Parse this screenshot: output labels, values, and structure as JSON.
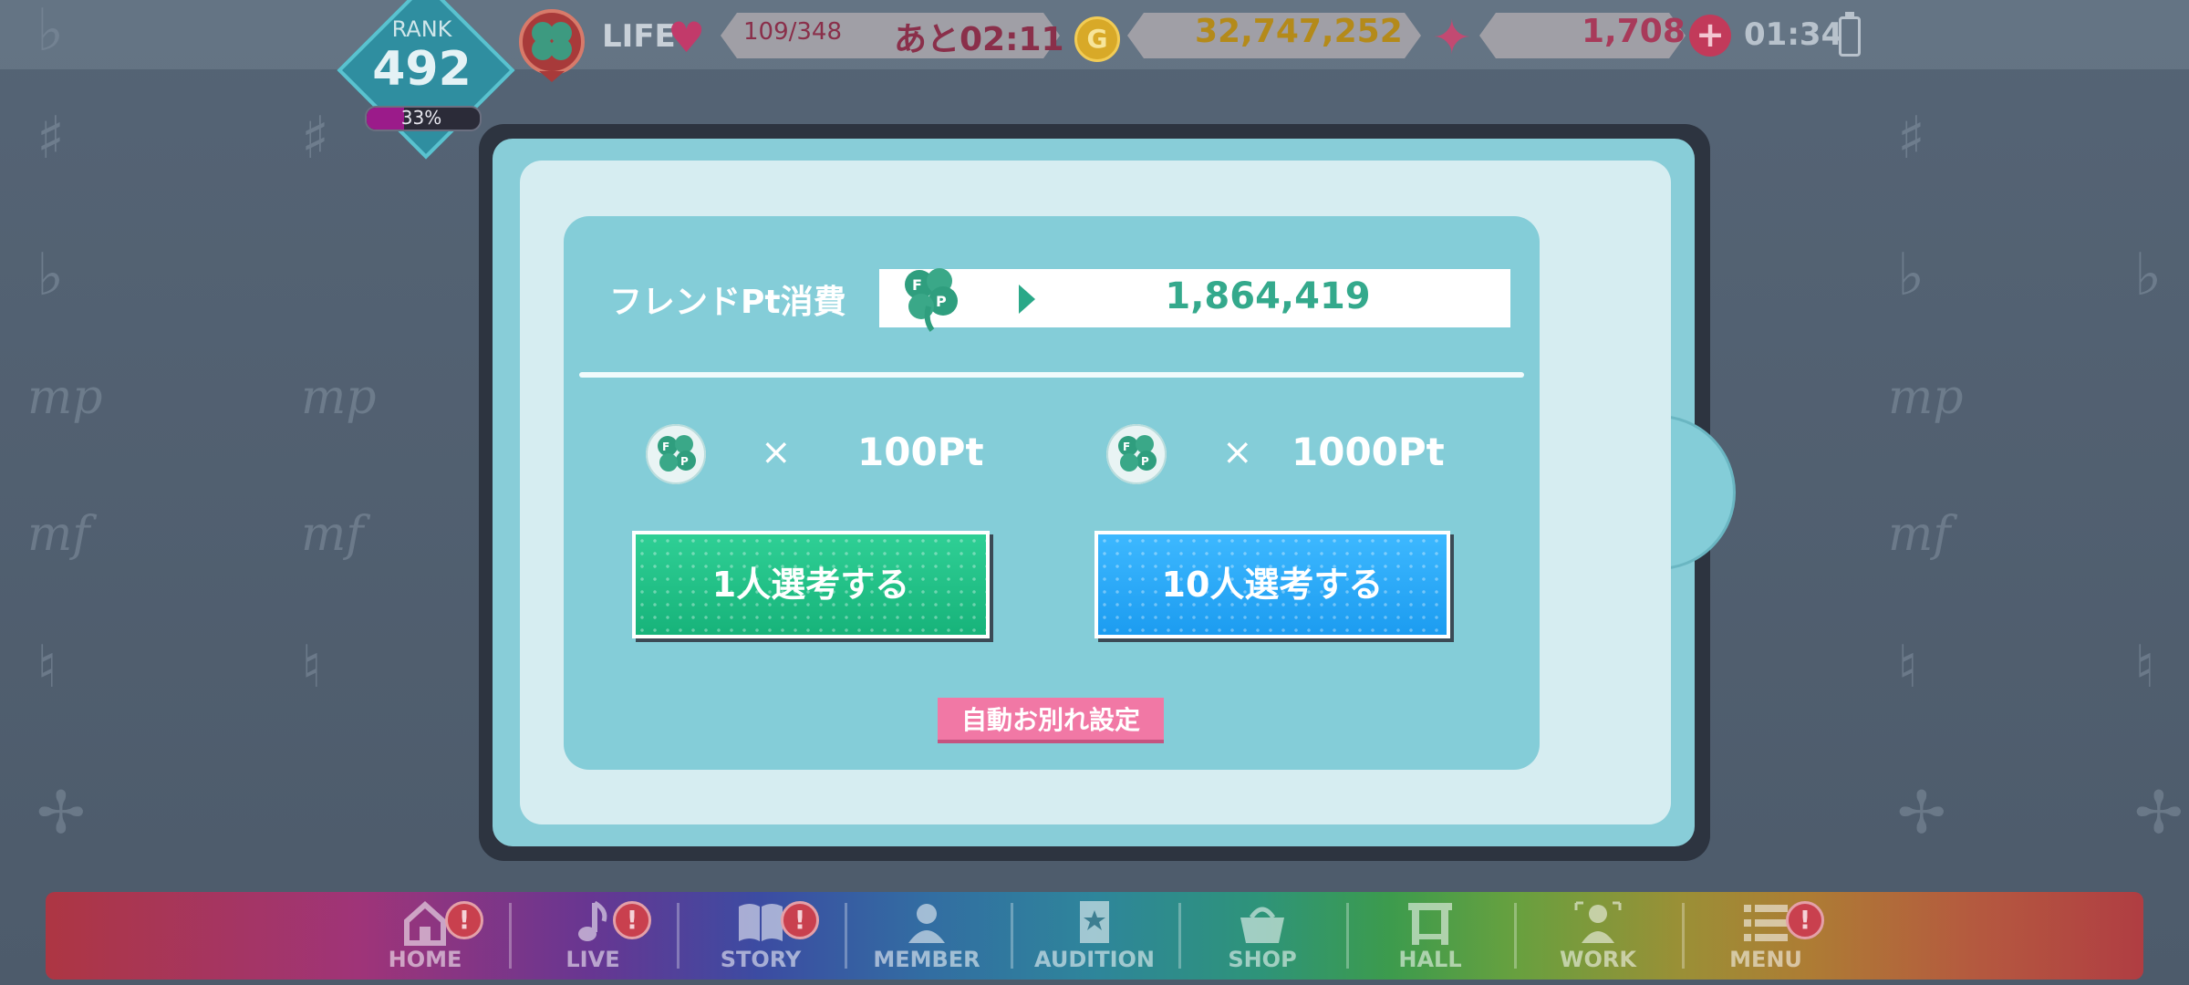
{
  "status": {
    "rank_label": "RANK",
    "rank_value": "492",
    "rank_progress_percent": 33,
    "rank_progress_text": "33%",
    "life_label": "LIFE",
    "life_value": "109/348",
    "life_timer": "あと02:11",
    "gold_icon": "G",
    "gold_value": "32,747,252",
    "gems_value": "1,708",
    "plus_icon": "+",
    "clock": "01:34"
  },
  "modal": {
    "cost_label": "フレンドPt消費",
    "cost_value": "1,864,419",
    "option_1": {
      "times": "×",
      "cost": "100Pt",
      "button": "1人選考する"
    },
    "option_10": {
      "times": "×",
      "cost": "1000Pt",
      "button": "10人選考する"
    },
    "auto_button": "自動お別れ設定",
    "close_icon": "✕"
  },
  "nav": {
    "items": [
      {
        "label": "HOME",
        "badge": "!"
      },
      {
        "label": "LIVE",
        "badge": "!"
      },
      {
        "label": "STORY",
        "badge": "!"
      },
      {
        "label": "MEMBER"
      },
      {
        "label": "AUDITION"
      },
      {
        "label": "SHOP"
      },
      {
        "label": "HALL"
      },
      {
        "label": "WORK"
      },
      {
        "label": "MENU",
        "badge": "!"
      }
    ]
  },
  "colors": {
    "accent_teal": "#84cdd8",
    "button_green": "#17b37a",
    "button_blue": "#1c9cf0",
    "button_pink": "#f178a5",
    "value_green": "#34a98c"
  }
}
